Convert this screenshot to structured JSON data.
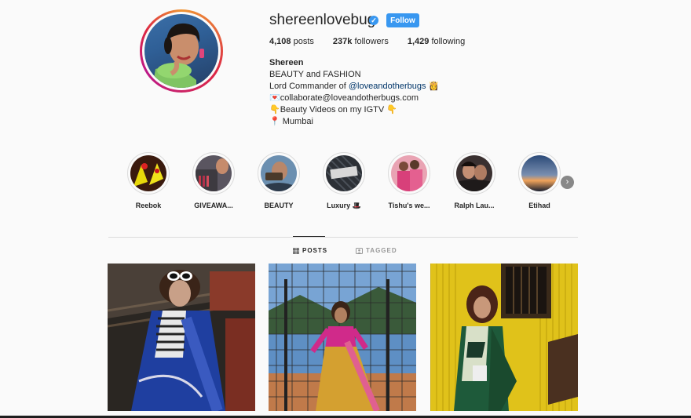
{
  "profile": {
    "username": "shereenlovebug",
    "verified_glyph": "✓",
    "follow_label": "Follow",
    "stats": {
      "posts_count": "4,108",
      "posts_label": "posts",
      "followers_count": "237k",
      "followers_label": "followers",
      "following_count": "1,429",
      "following_label": "following"
    },
    "bio": {
      "name": "Shereen",
      "line1": "BEAUTY and FASHION",
      "line2_prefix": "Lord Commander of ",
      "line2_link": "@loveandotherbugs",
      "line2_emoji": "👸",
      "line3_emoji": "💌",
      "line3_text": "collaborate@loveandotherbugs.com",
      "line4_emoji": "👇",
      "line4_text": "Beauty Videos on my IGTV",
      "line4_emoji_end": "👇",
      "line5_emoji": "📍",
      "line5_text": " Mumbai"
    }
  },
  "highlights": [
    {
      "label": "Reebok"
    },
    {
      "label": "GIVEAWA..."
    },
    {
      "label": "BEAUTY"
    },
    {
      "label": "Luxury 🎩"
    },
    {
      "label": "Tishu's we..."
    },
    {
      "label": "Ralph Lau..."
    },
    {
      "label": "Etihad"
    }
  ],
  "highlight_next_glyph": "›",
  "tabs": {
    "posts_label": "POSTS",
    "tagged_label": "TAGGED"
  },
  "colors": {
    "accent": "#3897f0",
    "text": "#262626",
    "muted": "#999999",
    "link": "#003569"
  }
}
